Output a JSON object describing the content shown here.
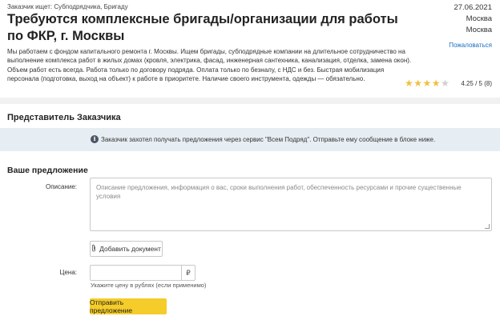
{
  "order": {
    "customer_line": "Заказчик ищет: Субподрядчика, Бригаду",
    "title": "Требуются комплексные бригады/организации для работы по ФКР, г. Москвы",
    "description": "Мы работаем с фондом капитального ремонта г. Москвы. Ищем бригады, субподрядные компании на длительное сотрудничество на выполнение комплекса работ в жилых домах (кровля, электрика, фасад, инженерная сантехника, канализация, отделка, замена окон). Объем работ есть всегда. Работа только по договору подряда. Оплата только по безналу, с НДС и без. Быстрая мобилизация персонала (подготовка, выход на объект) к работе в приоритете. Наличие своего инструмента, одежды — обязательно.",
    "date": "27.06.2021",
    "city_1": "Москва",
    "city_2": "Москва",
    "complain_label": "Пожаловаться",
    "rating": {
      "stars_filled": 4,
      "stars_total": 5,
      "text": "4.25 / 5 (8)"
    }
  },
  "representative": {
    "section_title": "Представитель Заказчика",
    "notice_icon": "info-icon",
    "notice": "Заказчик захотел получать предложения через сервис \"Всем Подряд\". Отправьте ему сообщение в блоке ниже."
  },
  "offer": {
    "section_title": "Ваше предложение",
    "description_label": "Описание:",
    "description_placeholder": "Описание предложения, информация о вас, сроки выполнения работ, обеспеченность ресурсами и прочие существенные условия",
    "add_document_label": "Добавить документ",
    "price_label": "Цена:",
    "price_value": "",
    "currency_symbol": "₽",
    "price_hint": "Укажите цену в рублях (если применимо)",
    "submit_label": "Отправить предложение"
  },
  "colors": {
    "accent_yellow": "#f5cc29",
    "link_blue": "#1a6fc1",
    "star_gold": "#f0c040",
    "notice_bg": "#e6edf3"
  }
}
